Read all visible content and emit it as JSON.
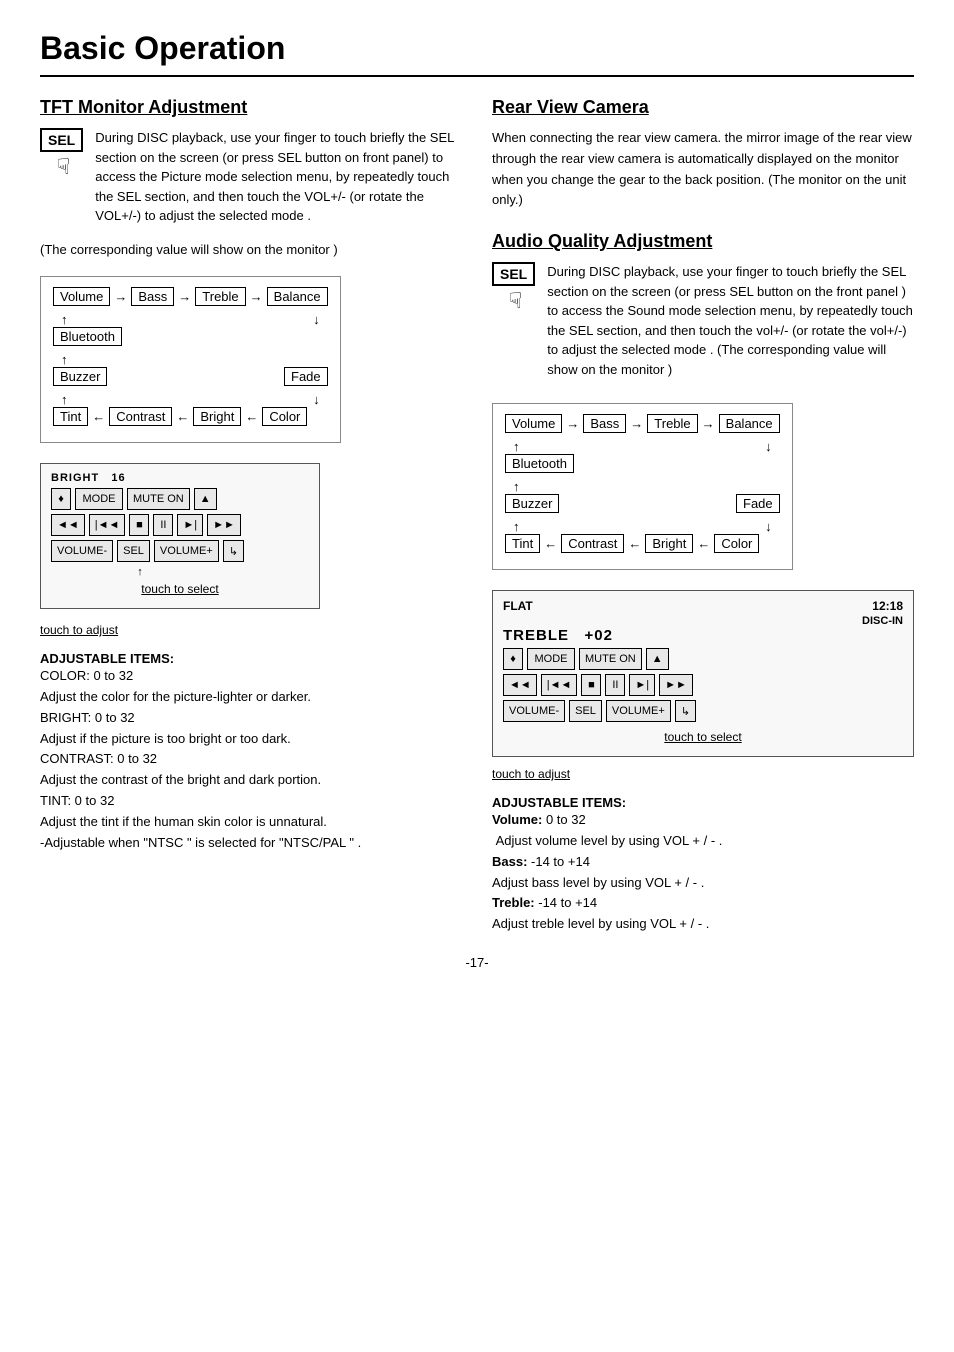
{
  "page": {
    "title": "Basic Operation",
    "number": "-17-"
  },
  "left": {
    "section_title": "TFT Monitor Adjustment",
    "sel_label": "SEL",
    "hand_icon": "☟",
    "intro_text": "During DISC playback, use your finger to touch briefly the SEL section on the screen (or press SEL button on front panel) to access the Picture mode selection menu, by repeatedly touch the SEL section, and then touch the VOL+/- (or rotate the VOL+/-) to adjust the selected mode .",
    "monitor_note": "(The corresponding value will show on the monitor )",
    "flow": {
      "row1": [
        "Volume",
        "→",
        "Bass",
        "→",
        "Treble",
        "→",
        "Balance"
      ],
      "row2_left": [
        "Bluetooth"
      ],
      "row3_left": [
        "Buzzer"
      ],
      "row3_right": [
        "Fade"
      ],
      "row4": [
        "Tint",
        "←",
        "Contrast",
        "←",
        "Bright",
        "←",
        "Color"
      ]
    },
    "panel": {
      "bright_label": "BRIGHT",
      "bright_value": "16",
      "row1": [
        "♦",
        "MODE",
        "MUTE ON",
        "▲"
      ],
      "row2": [
        "◄◄",
        "◄◄",
        "■",
        "II",
        "►|",
        "►►"
      ],
      "row3": [
        "VOLUME-",
        "SEL",
        "VOLUME+",
        "↳"
      ],
      "touch_select": "touch to select"
    },
    "touch_adjust": "touch to adjust",
    "adj_title": "ADJUSTABLE  ITEMS:",
    "adj_items": [
      "COLOR: 0 to 32",
      "Adjust the color for the picture-lighter or darker.",
      "BRIGHT: 0 to 32",
      "Adjust if the picture is too bright or too dark.",
      "CONTRAST: 0 to 32",
      "Adjust the contrast of the bright and dark portion.",
      "TINT: 0 to 32",
      "Adjust the tint if the human skin color is unnatural.",
      "-Adjustable when \"NTSC \" is selected for \"NTSC/PAL \" ."
    ]
  },
  "right": {
    "rear_title": "Rear View Camera",
    "rear_text": "When connecting the rear view camera. the mirror image of the rear view through the rear view camera is automatically displayed on the monitor when you change  the gear to the back position. (The monitor on the unit only.)",
    "section_title": "Audio Quality Adjustment",
    "sel_label": "SEL",
    "hand_icon": "☟",
    "intro_text": "During DISC playback, use your finger to touch briefly the SEL section on the screen (or press SEL button on the front panel ) to access the Sound mode selection menu, by repeatedly touch the SEL section, and then touch the vol+/- (or rotate the vol+/-) to adjust the selected mode . (The corresponding value will show on the monitor )",
    "flow": {
      "row1": [
        "Volume",
        "→",
        "Bass",
        "→",
        "Treble",
        "→",
        "Balance"
      ],
      "row2_left": [
        "Bluetooth"
      ],
      "row3_left": [
        "Buzzer"
      ],
      "row3_right": [
        "Fade"
      ],
      "row4": [
        "Tint",
        "←",
        "Contrast",
        "←",
        "Bright",
        "←",
        "Color"
      ]
    },
    "panel": {
      "flat_label": "FLAT",
      "time_label": "12:18",
      "disc_in": "DISC-IN",
      "treble_label": "TREBLE",
      "treble_value": "+02",
      "row1": [
        "♦",
        "MODE",
        "MUTE ON",
        "▲"
      ],
      "row2": [
        "◄◄",
        "◄◄",
        "■",
        "II",
        "►|",
        "►►"
      ],
      "row3": [
        "VOLUME-",
        "SEL",
        "VOLUME+",
        "↳"
      ],
      "touch_select": "touch to select"
    },
    "touch_adjust": "touch to adjust",
    "adj_title": "ADJUSTABLE  ITEMS:",
    "adj_items": [
      {
        "bold": "Volume:",
        "text": " 0 to 32"
      },
      {
        "bold": "",
        "text": " Adjust volume level by using VOL + / - ."
      },
      {
        "bold": "Bass:",
        "text": " -14 to +14"
      },
      {
        "bold": "",
        "text": "Adjust bass level by using VOL + / - ."
      },
      {
        "bold": "Treble:",
        "text": " -14 to +14"
      },
      {
        "bold": "",
        "text": "Adjust treble level by using VOL + / - ."
      }
    ]
  }
}
